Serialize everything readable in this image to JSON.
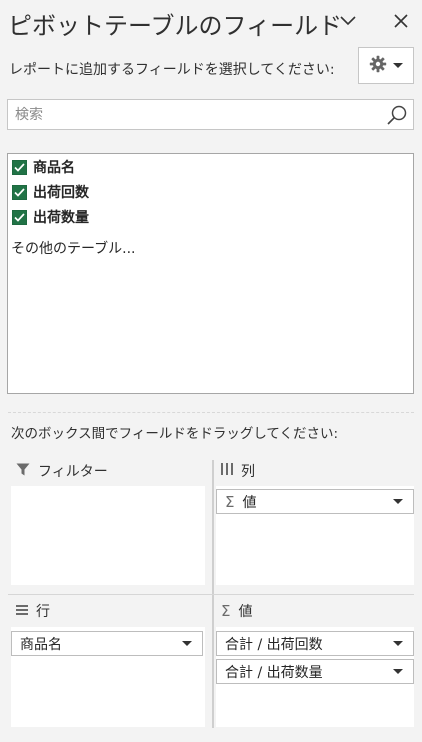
{
  "pane": {
    "title": "ピボットテーブルのフィールド",
    "subtitle": "レポートに追加するフィールドを選択してください:"
  },
  "search": {
    "placeholder": "検索",
    "value": ""
  },
  "fields": [
    {
      "label": "商品名",
      "checked": true
    },
    {
      "label": "出荷回数",
      "checked": true
    },
    {
      "label": "出荷数量",
      "checked": true
    }
  ],
  "more_tables": "その他のテーブル...",
  "drag_instruction": "次のボックス間でフィールドをドラッグしてください:",
  "areas": {
    "filters": {
      "label": "フィルター",
      "items": []
    },
    "columns": {
      "label": "列",
      "items": [
        "値"
      ]
    },
    "rows": {
      "label": "行",
      "items": [
        "商品名"
      ]
    },
    "values": {
      "label": "値",
      "items": [
        "合計 / 出荷回数",
        "合計 / 出荷数量"
      ]
    }
  },
  "colors": {
    "accent_checkbox": "#217346",
    "pane_background": "#f3f3f3"
  },
  "icons": [
    "chevron-down-icon",
    "close-icon",
    "gear-icon",
    "search-icon",
    "checkbox-checked-icon",
    "filter-icon",
    "columns-icon",
    "rows-icon",
    "sigma-icon",
    "dropdown-caret-icon"
  ]
}
